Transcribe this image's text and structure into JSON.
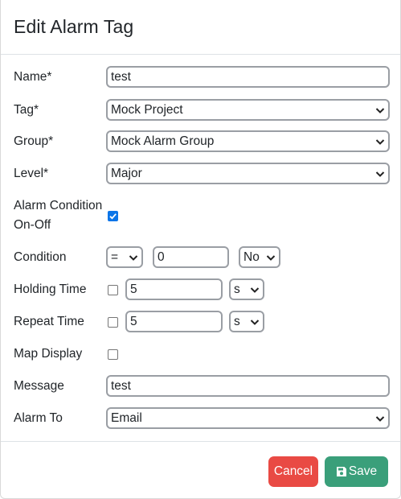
{
  "modal": {
    "title": "Edit Alarm Tag"
  },
  "form": {
    "name": {
      "label": "Name*",
      "value": "test"
    },
    "tag": {
      "label": "Tag*",
      "value": "Mock Project"
    },
    "group": {
      "label": "Group*",
      "value": "Mock Alarm Group"
    },
    "level": {
      "label": "Level*",
      "value": "Major"
    },
    "alarm_condition": {
      "label_line1": "Alarm Condition",
      "label_line2": "On-Off",
      "checked": true
    },
    "condition": {
      "label": "Condition",
      "operator": "=",
      "value": "0",
      "flag": "No"
    },
    "holding_time": {
      "label": "Holding Time",
      "checked": false,
      "value": "5",
      "unit": "s"
    },
    "repeat_time": {
      "label": "Repeat Time",
      "checked": false,
      "value": "5",
      "unit": "s"
    },
    "map_display": {
      "label": "Map Display",
      "checked": false
    },
    "message": {
      "label": "Message",
      "value": "test"
    },
    "alarm_to": {
      "label": "Alarm To",
      "value": "Email"
    }
  },
  "footer": {
    "cancel_label": "Cancel",
    "save_label": "Save"
  },
  "colors": {
    "cancel": "#e94a44",
    "save": "#3a9f7a",
    "checkbox_checked": "#0b75e8"
  },
  "icons": {
    "select_arrow": "chevron-down-icon",
    "save": "floppy-disk-icon",
    "check": "checkmark-icon"
  }
}
